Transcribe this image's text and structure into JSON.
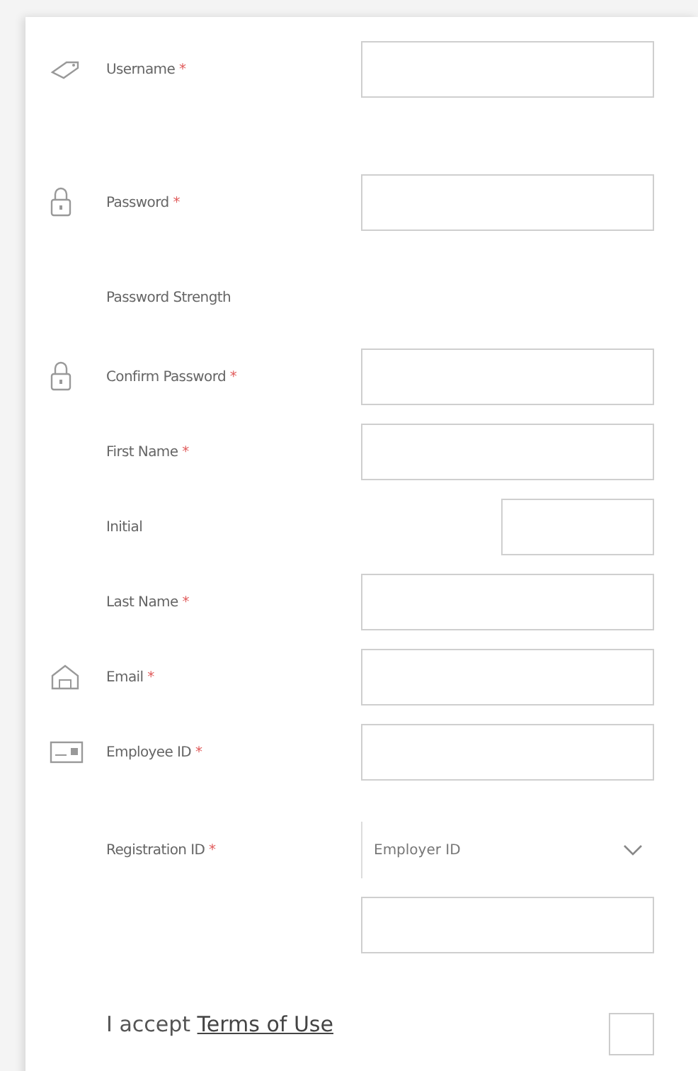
{
  "form": {
    "rows": [
      {
        "kind": "field",
        "label": "Username",
        "mark": "*"
      },
      {
        "kind": "field",
        "label": "Password",
        "mark": "*"
      },
      {
        "kind": "text",
        "label": "Password Strength"
      },
      {
        "kind": "field",
        "label": "Confirm Password",
        "mark": "*"
      },
      {
        "kind": "field",
        "label": "First Name",
        "mark": "*"
      },
      {
        "kind": "short",
        "label": "Initial"
      },
      {
        "kind": "field",
        "label": "Last Name",
        "mark": "*"
      },
      {
        "kind": "field",
        "label": "Email",
        "mark": "*"
      },
      {
        "kind": "field",
        "label": "Employee ID",
        "mark": "*"
      },
      {
        "kind": "select",
        "label": "Registration ID",
        "mark": "*",
        "value": "Employer ID"
      },
      {
        "kind": "blank"
      }
    ],
    "terms": {
      "text": "I accept",
      "link": "Terms of Use",
      "checked": false
    }
  }
}
